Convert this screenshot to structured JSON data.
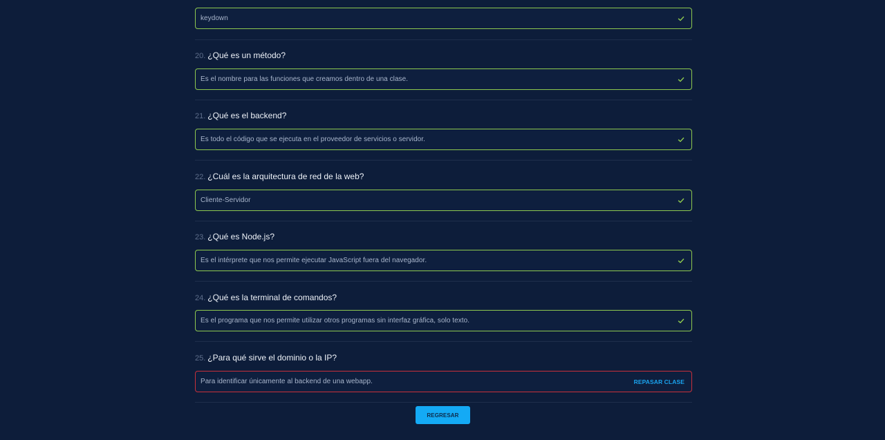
{
  "quiz": {
    "partial_answer": "keydown",
    "items": [
      {
        "number": "20.",
        "question": "¿Qué es un método?",
        "answer": "Es el nombre para las funciones que creamos dentro de una clase.",
        "status": "correct"
      },
      {
        "number": "21.",
        "question": "¿Qué es el backend?",
        "answer": "Es todo el código que se ejecuta en el proveedor de servicios o servidor.",
        "status": "correct"
      },
      {
        "number": "22.",
        "question": "¿Cuál es la arquitectura de red de la web?",
        "answer": "Cliente-Servidor",
        "status": "correct"
      },
      {
        "number": "23.",
        "question": "¿Qué es Node.js?",
        "answer": "Es el intérprete que nos permite ejecutar JavaScript fuera del navegador.",
        "status": "correct"
      },
      {
        "number": "24.",
        "question": "¿Qué es la terminal de comandos?",
        "answer": "Es el programa que nos permite utilizar otros programas sin interfaz gráfica, solo texto.",
        "status": "correct"
      },
      {
        "number": "25.",
        "question": "¿Para qué sirve el dominio o la IP?",
        "answer": "Para identificar únicamente al backend de una webapp.",
        "status": "incorrect",
        "review_label": "REPASAR CLASE"
      }
    ]
  },
  "actions": {
    "back_label": "REGRESAR"
  },
  "colors": {
    "background": "#0d1d3a",
    "correct_border": "#8ec94f",
    "incorrect_border": "#c9303a",
    "accent": "#14aaf5"
  },
  "icons": {
    "correct": "check-icon"
  }
}
